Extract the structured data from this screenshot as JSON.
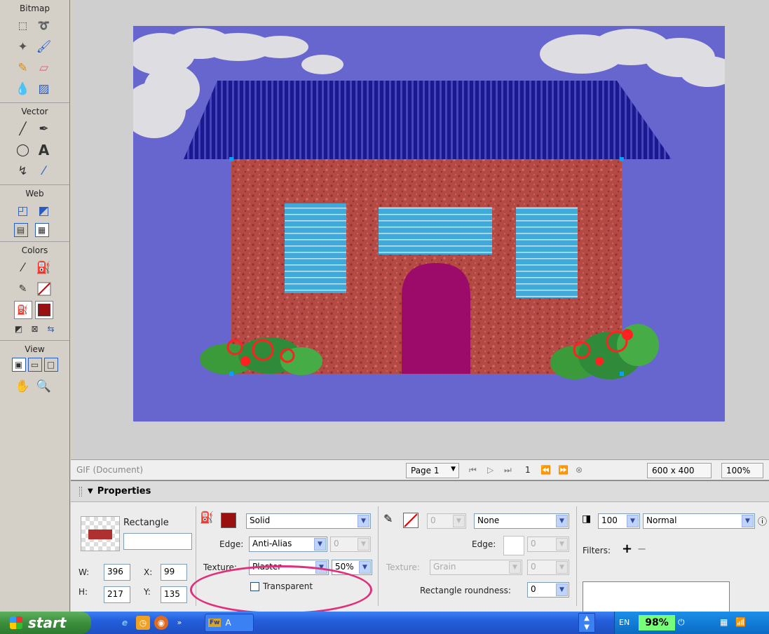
{
  "tools": {
    "bitmap_title": "Bitmap",
    "vector_title": "Vector",
    "web_title": "Web",
    "colors_title": "Colors",
    "view_title": "View",
    "text_tool_glyph": "A"
  },
  "colors": {
    "canvas_bg": "#6766cf",
    "fill": "#9a1010",
    "stroke": "#ffffff",
    "roof": "#1a1a8c",
    "wall": "#b54a45",
    "window": "#3fa9d9",
    "door": "#9c0a6a",
    "bush": "#3b9b3b",
    "flower": "#ff2020",
    "highlight": "#e0307c"
  },
  "status": {
    "doc_label": "GIF (Document)",
    "page_select": "Page 1",
    "page_number": "1",
    "doc_size": "600 x 400",
    "zoom": "100%"
  },
  "properties": {
    "title": "Properties",
    "object_type": "Rectangle",
    "object_name": "",
    "w_label": "W:",
    "w_value": "396",
    "h_label": "H:",
    "h_value": "217",
    "x_label": "X:",
    "x_value": "99",
    "y_label": "Y:",
    "y_value": "135",
    "fill_type": "Solid",
    "edge_label": "Edge:",
    "edge_value": "Anti-Alias",
    "edge_amount": "0",
    "texture_label": "Texture:",
    "texture_value": "Plaster",
    "texture_amount": "50%",
    "transparent_label": "Transparent",
    "stroke_size": "0",
    "stroke_type": "None",
    "stroke_edge_label": "Edge:",
    "stroke_edge_amount": "0",
    "stroke_texture_label": "Texture:",
    "stroke_texture_value": "Grain",
    "stroke_texture_amount": "0",
    "roundness_label": "Rectangle roundness:",
    "roundness_value": "0",
    "opacity_value": "100",
    "blend_mode": "Normal",
    "filters_label": "Filters:",
    "add_filter": "+",
    "remove_filter": "−"
  },
  "taskbar": {
    "start_label": "start",
    "task_label": "A",
    "task_icon": "Fw",
    "lang": "EN",
    "battery": "98%"
  }
}
